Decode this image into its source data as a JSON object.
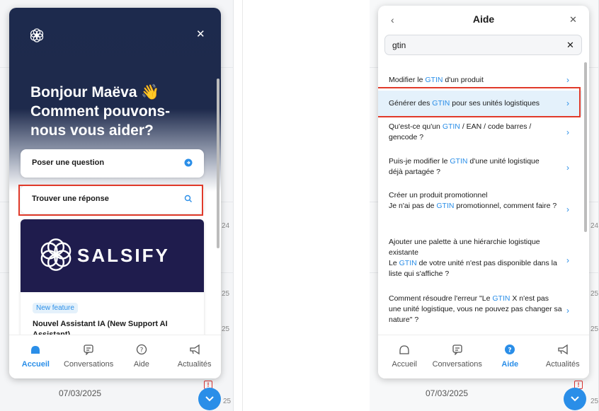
{
  "background": {
    "date_left": "07/03/2025",
    "date_right": "07/03/2025",
    "edge_numbers": [
      "24",
      "25",
      "25",
      "25",
      "24",
      "25",
      "25",
      "25"
    ]
  },
  "left_widget": {
    "greeting_line1": "Bonjour Maëva 👋",
    "greeting_line2": "Comment pouvons-nous vous aider?",
    "ask_label": "Poser une question",
    "find_label": "Trouver une réponse",
    "banner_text": "SALSIFY",
    "badge": "New feature",
    "feature_title": "Nouvel Assistant IA (New Support AI Assistant)",
    "tabs": [
      {
        "label": "Accueil",
        "icon": "home-icon",
        "active": true
      },
      {
        "label": "Conversations",
        "icon": "chat-icon",
        "active": false
      },
      {
        "label": "Aide",
        "icon": "help-icon",
        "active": false
      },
      {
        "label": "Actualités",
        "icon": "megaphone-icon",
        "active": false
      }
    ]
  },
  "right_widget": {
    "title": "Aide",
    "search_value": "gtin",
    "results": [
      {
        "pre": "Modifier le ",
        "hl": "GTIN",
        "post": " d'un produit"
      },
      {
        "pre": "Générer des ",
        "hl": "GTIN",
        "post": " pour ses unités logistiques"
      },
      {
        "pre": "Qu'est-ce qu'un ",
        "hl": "GTIN",
        "post": " / EAN / code barres / gencode ?"
      },
      {
        "pre": "Puis-je modifier le ",
        "hl": "GTIN",
        "post": " d'une unité logistique déjà partagée ?"
      },
      {
        "line1": "Créer un produit promotionnel",
        "pre": "Je n'ai pas de ",
        "hl": "GTIN",
        "post": " promotionnel, comment faire ?"
      },
      {
        "line1": "Ajouter une palette à une hiérarchie logistique existante",
        "pre": "Le ",
        "hl": "GTIN",
        "post": " de votre unité n'est pas disponible dans la liste qui s'affiche ?"
      },
      {
        "pre": "Comment résoudre l'erreur \"Le ",
        "hl": "GTIN",
        "post": " X n'est pas une unité logistique, vous ne pouvez pas changer sa nature\" ?"
      }
    ],
    "tabs": [
      {
        "label": "Accueil",
        "icon": "home-icon",
        "active": false
      },
      {
        "label": "Conversations",
        "icon": "chat-icon",
        "active": false
      },
      {
        "label": "Aide",
        "icon": "help-icon",
        "active": true
      },
      {
        "label": "Actualités",
        "icon": "megaphone-icon",
        "active": false
      }
    ]
  },
  "colors": {
    "accent": "#2a8ee8",
    "highlight_border": "#e03a2a",
    "hero": "#1d2a4d"
  }
}
